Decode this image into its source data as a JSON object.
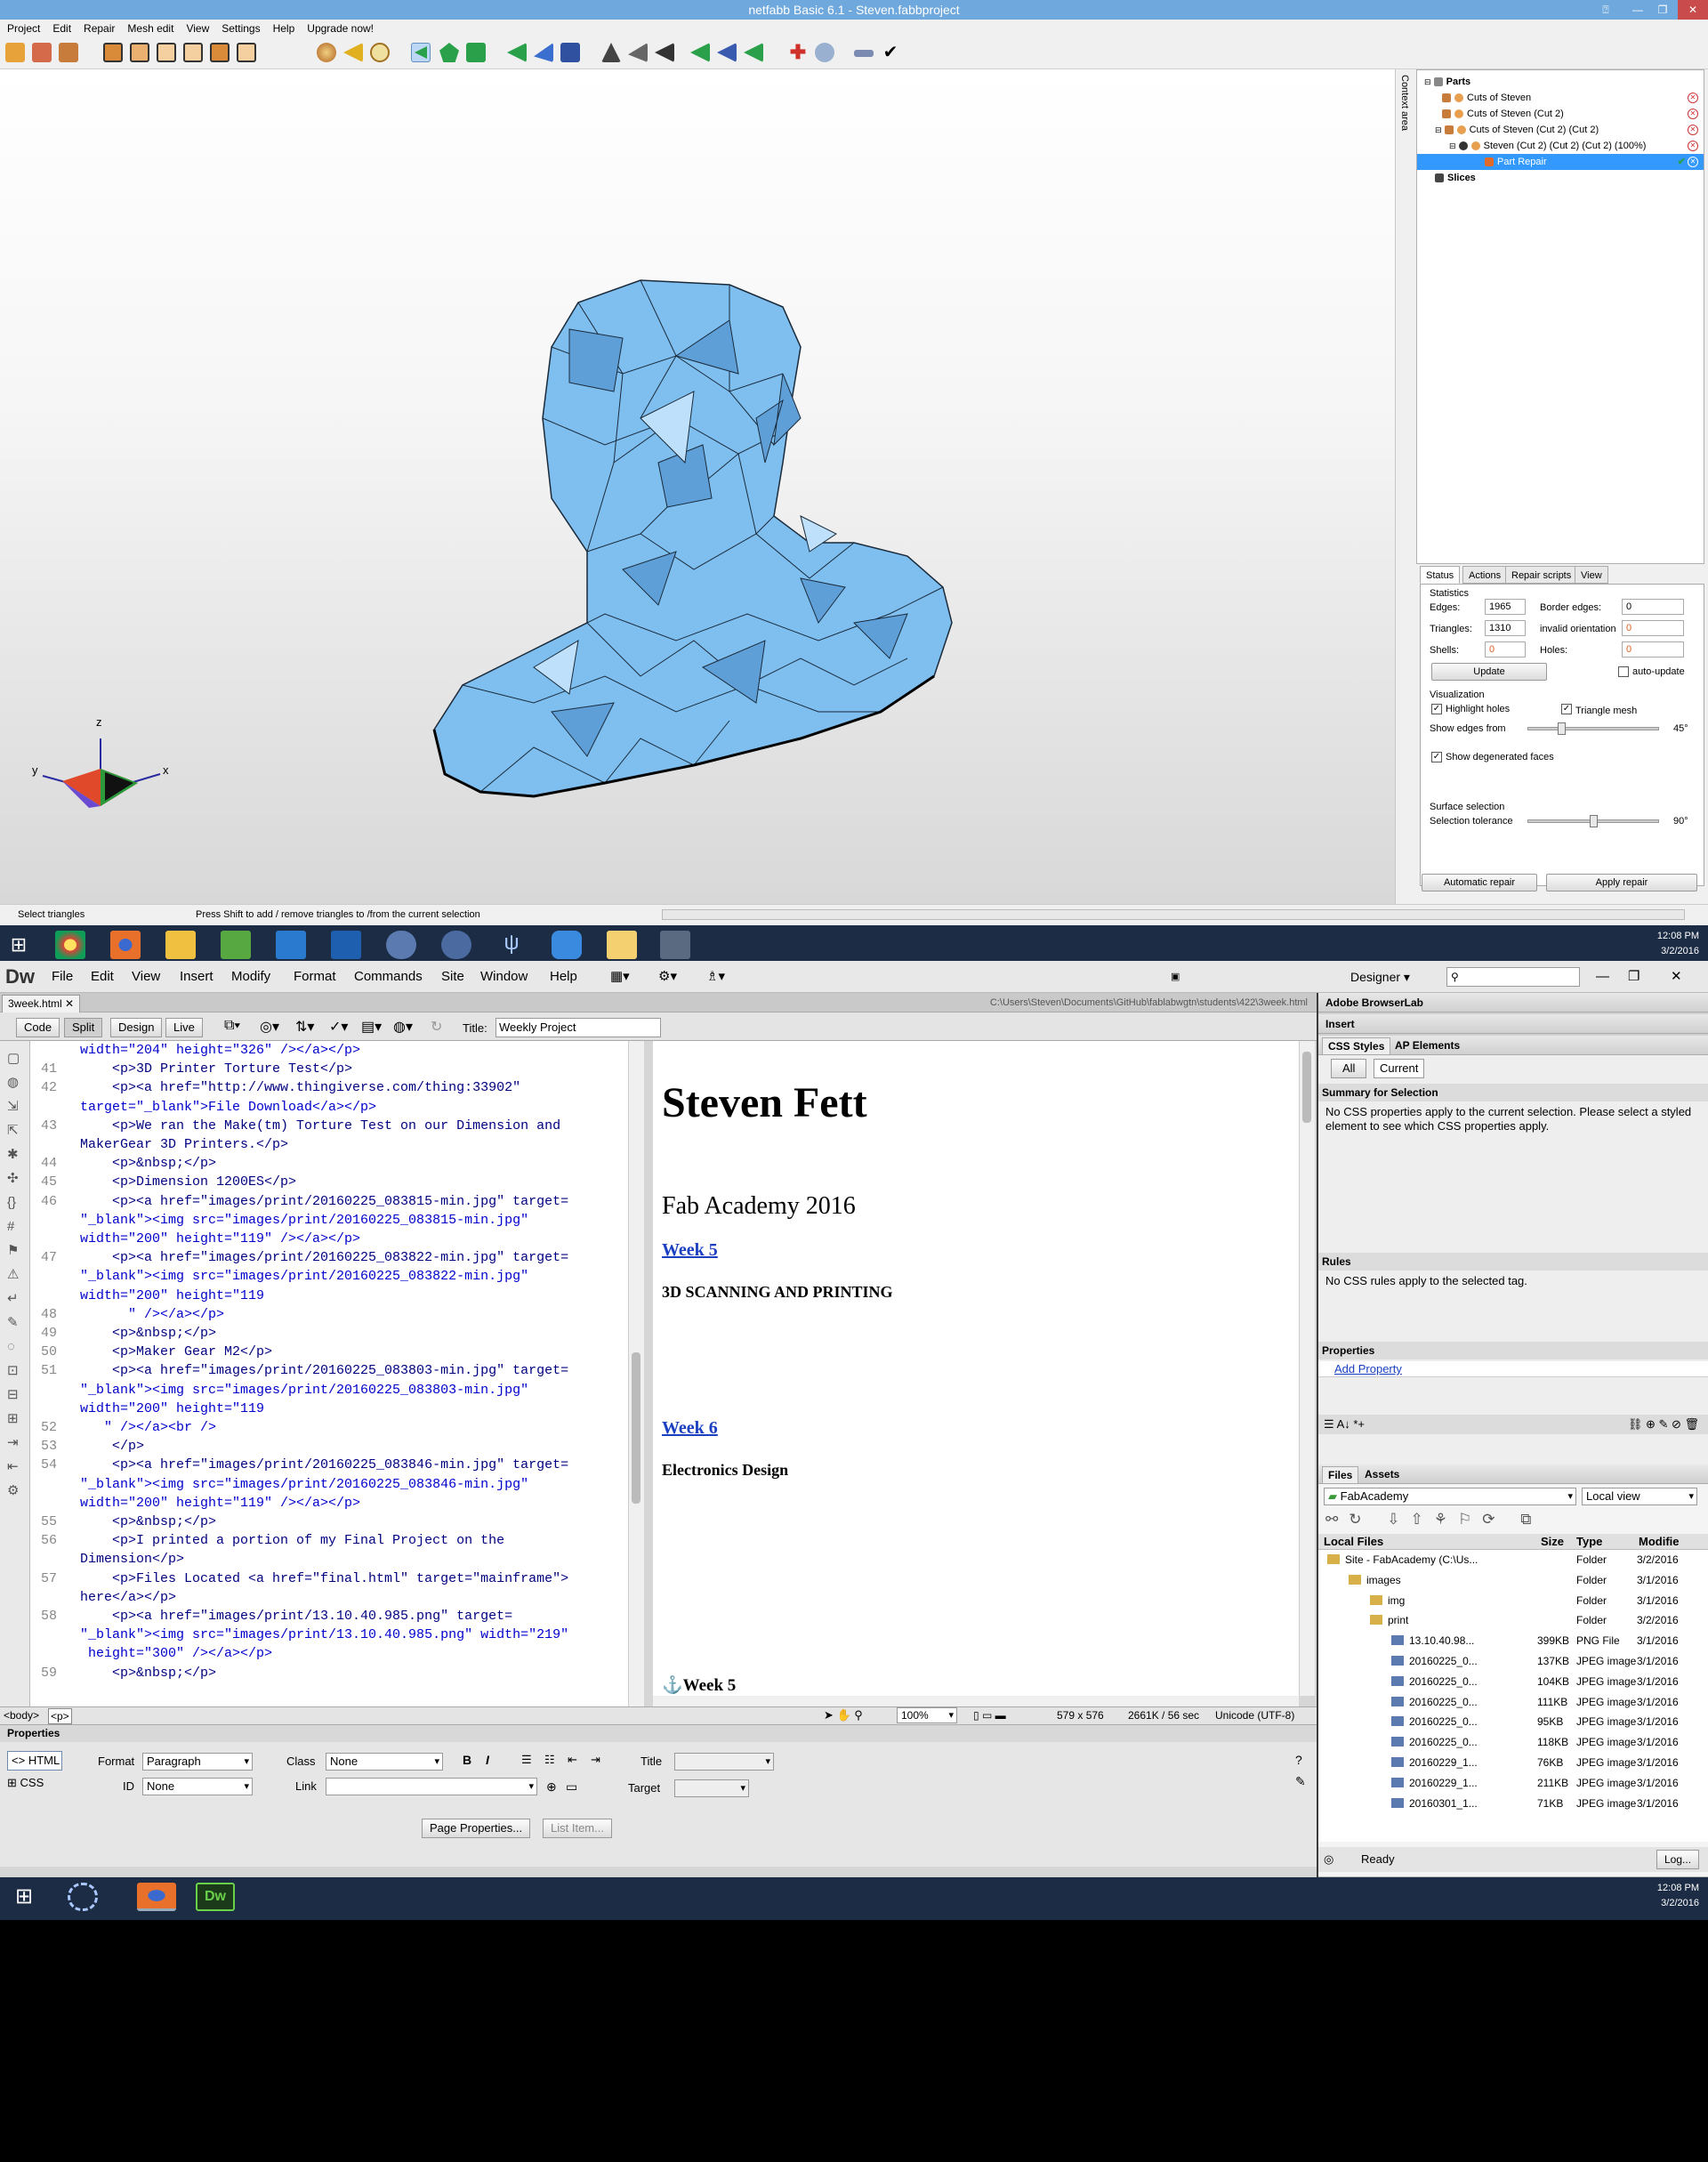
{
  "netfabb": {
    "title": "netfabb Basic 6.1 - Steven.fabbproject",
    "menu": [
      "Project",
      "Edit",
      "Repair",
      "Mesh edit",
      "View",
      "Settings",
      "Help",
      "Upgrade now!"
    ],
    "context_area": "Context area",
    "parts_header": "Parts",
    "tree": [
      "Cuts of Steven",
      "Cuts of Steven (Cut 2)",
      "Cuts of Steven (Cut 2) (Cut 2)",
      "Steven (Cut 2) (Cut 2) (Cut 2) (100%)",
      "Part Repair"
    ],
    "slices": "Slices",
    "tabs": [
      "Status",
      "Actions",
      "Repair scripts",
      "View"
    ],
    "statistics": "Statistics",
    "edges_label": "Edges:",
    "edges": "1965",
    "triangles_label": "Triangles:",
    "triangles": "1310",
    "shells_label": "Shells:",
    "shells": "0",
    "border_edges_label": "Border edges:",
    "border_edges": "0",
    "invalid_orientation_label": "invalid orientation",
    "invalid_orientation": "0",
    "holes_label": "Holes:",
    "holes": "0",
    "update": "Update",
    "auto_update": "auto-update",
    "visualization": "Visualization",
    "highlight_holes": "Highlight holes",
    "triangle_mesh": "Triangle mesh",
    "show_edges_from": "Show edges from",
    "edges_angle": "45°",
    "show_degenerated": "Show degenerated faces",
    "surface_selection": "Surface selection",
    "selection_tolerance": "Selection tolerance",
    "tolerance_value": "90°",
    "automatic_repair": "Automatic repair",
    "apply_repair": "Apply repair",
    "status_left": "Select triangles",
    "status_mid": "Press Shift to add / remove triangles to /from the current selection",
    "axis": {
      "z": "z",
      "y": "y",
      "x": "x"
    }
  },
  "taskbar1": {
    "time": "12:08 PM",
    "date": "3/2/2016"
  },
  "dreamweaver": {
    "logo": "Dw",
    "menu": [
      "File",
      "Edit",
      "View",
      "Insert",
      "Modify",
      "Format",
      "Commands",
      "Site",
      "Window",
      "Help"
    ],
    "workspace": "Designer",
    "doc_tab": "3week.html",
    "doc_path": "C:\\Users\\Steven\\Documents\\GitHub\\fablabwgtn\\students\\422\\3week.html",
    "views": [
      "Code",
      "Split",
      "Design",
      "Live"
    ],
    "title_label": "Title:",
    "title_value": "Weekly Project",
    "code_lines": [
      {
        "n": "",
        "t": "width=\"204\" height=\"326\" /></a></p>"
      },
      {
        "n": "41",
        "t": "    <p>3D Printer Torture Test</p>"
      },
      {
        "n": "42",
        "t": "    <p><a href=\"http://www.thingiverse.com/thing:33902\""
      },
      {
        "n": "",
        "t": "target=\"_blank\">File Download</a></p>"
      },
      {
        "n": "43",
        "t": "    <p>We ran the Make(tm) Torture Test on our Dimension and"
      },
      {
        "n": "",
        "t": "MakerGear 3D Printers.</p>"
      },
      {
        "n": "44",
        "t": "    <p>&nbsp;</p>"
      },
      {
        "n": "45",
        "t": "    <p>Dimension 1200ES</p>"
      },
      {
        "n": "46",
        "t": "    <p><a href=\"images/print/20160225_083815-min.jpg\" target="
      },
      {
        "n": "",
        "t": "\"_blank\"><img src=\"images/print/20160225_083815-min.jpg\""
      },
      {
        "n": "",
        "t": "width=\"200\" height=\"119\" /></a></p>"
      },
      {
        "n": "47",
        "t": "    <p><a href=\"images/print/20160225_083822-min.jpg\" target="
      },
      {
        "n": "",
        "t": "\"_blank\"><img src=\"images/print/20160225_083822-min.jpg\""
      },
      {
        "n": "",
        "t": "width=\"200\" height=\"119"
      },
      {
        "n": "48",
        "t": "      \" /></a></p>"
      },
      {
        "n": "49",
        "t": "    <p>&nbsp;</p>"
      },
      {
        "n": "50",
        "t": "    <p>Maker Gear M2</p>"
      },
      {
        "n": "51",
        "t": "    <p><a href=\"images/print/20160225_083803-min.jpg\" target="
      },
      {
        "n": "",
        "t": "\"_blank\"><img src=\"images/print/20160225_083803-min.jpg\""
      },
      {
        "n": "",
        "t": "width=\"200\" height=\"119"
      },
      {
        "n": "52",
        "t": "   \" /></a><br />"
      },
      {
        "n": "53",
        "t": "    </p>"
      },
      {
        "n": "54",
        "t": "    <p><a href=\"images/print/20160225_083846-min.jpg\" target="
      },
      {
        "n": "",
        "t": "\"_blank\"><img src=\"images/print/20160225_083846-min.jpg\""
      },
      {
        "n": "",
        "t": "width=\"200\" height=\"119\" /></a></p>"
      },
      {
        "n": "55",
        "t": "    <p>&nbsp;</p>"
      },
      {
        "n": "56",
        "t": "    <p>I printed a portion of my Final Project on the"
      },
      {
        "n": "",
        "t": "Dimension</p>"
      },
      {
        "n": "57",
        "t": "    <p>Files Located <a href=\"final.html\" target=\"mainframe\">"
      },
      {
        "n": "",
        "t": "here</a></p>"
      },
      {
        "n": "58",
        "t": "    <p><a href=\"images/print/13.10.40.985.png\" target="
      },
      {
        "n": "",
        "t": "\"_blank\"><img src=\"images/print/13.10.40.985.png\" width=\"219\""
      },
      {
        "n": "",
        "t": " height=\"300\" /></a></p>"
      },
      {
        "n": "59",
        "t": "    <p>&nbsp;</p>"
      }
    ],
    "design": {
      "h1": "Steven Fett",
      "subtitle": "Fab Academy 2016",
      "week5": "Week 5",
      "week5_desc": "3D SCANNING AND PRINTING",
      "week6": "Week 6",
      "week6_desc": "Electronics Design",
      "week5_anchor": "Week 5"
    },
    "tag_selector": [
      "<body>",
      "<p>"
    ],
    "status": {
      "zoom": "100%",
      "size": "579 x 576",
      "weight": "2661K / 56 sec",
      "encoding": "Unicode (UTF-8)"
    },
    "properties": {
      "header": "Properties",
      "html": "HTML",
      "css": "CSS",
      "format_label": "Format",
      "format_value": "Paragraph",
      "id_label": "ID",
      "id_value": "None",
      "class_label": "Class",
      "class_value": "None",
      "link_label": "Link",
      "title_label": "Title",
      "target_label": "Target",
      "page_properties": "Page Properties...",
      "list_item": "List Item..."
    },
    "panels": {
      "browserlab": "Adobe BrowserLab",
      "insert": "Insert",
      "css_styles": "CSS Styles",
      "ap_elements": "AP Elements",
      "all": "All",
      "current": "Current",
      "summary": "Summary for Selection",
      "summary_text": "No CSS properties apply to the current selection.  Please select a styled element to see which CSS properties apply.",
      "rules": "Rules",
      "rules_text": "No CSS rules apply to the selected tag.",
      "properties": "Properties",
      "add_property": "Add Property",
      "files": "Files",
      "assets": "Assets",
      "site": "FabAcademy",
      "view": "Local view",
      "cols": [
        "Local Files",
        "Size",
        "Type",
        "Modifie"
      ],
      "files_list": [
        {
          "name": "Site - FabAcademy (C:\\Us...",
          "size": "",
          "type": "Folder",
          "date": "3/2/2016",
          "indent": 0
        },
        {
          "name": "images",
          "size": "",
          "type": "Folder",
          "date": "3/1/2016",
          "indent": 1
        },
        {
          "name": "img",
          "size": "",
          "type": "Folder",
          "date": "3/1/2016",
          "indent": 2
        },
        {
          "name": "print",
          "size": "",
          "type": "Folder",
          "date": "3/2/2016",
          "indent": 2
        },
        {
          "name": "13.10.40.98...",
          "size": "399KB",
          "type": "PNG File",
          "date": "3/1/2016",
          "indent": 3
        },
        {
          "name": "20160225_0...",
          "size": "137KB",
          "type": "JPEG image",
          "date": "3/1/2016",
          "indent": 3
        },
        {
          "name": "20160225_0...",
          "size": "104KB",
          "type": "JPEG image",
          "date": "3/1/2016",
          "indent": 3
        },
        {
          "name": "20160225_0...",
          "size": "111KB",
          "type": "JPEG image",
          "date": "3/1/2016",
          "indent": 3
        },
        {
          "name": "20160225_0...",
          "size": "95KB",
          "type": "JPEG image",
          "date": "3/1/2016",
          "indent": 3
        },
        {
          "name": "20160225_0...",
          "size": "118KB",
          "type": "JPEG image",
          "date": "3/1/2016",
          "indent": 3
        },
        {
          "name": "20160229_1...",
          "size": "76KB",
          "type": "JPEG image",
          "date": "3/1/2016",
          "indent": 3
        },
        {
          "name": "20160229_1...",
          "size": "211KB",
          "type": "JPEG image",
          "date": "3/1/2016",
          "indent": 3
        },
        {
          "name": "20160301_1...",
          "size": "71KB",
          "type": "JPEG image",
          "date": "3/1/2016",
          "indent": 3
        }
      ],
      "ready": "Ready",
      "log": "Log..."
    }
  },
  "taskbar2": {
    "time": "12:08 PM",
    "date": "3/2/2016"
  }
}
